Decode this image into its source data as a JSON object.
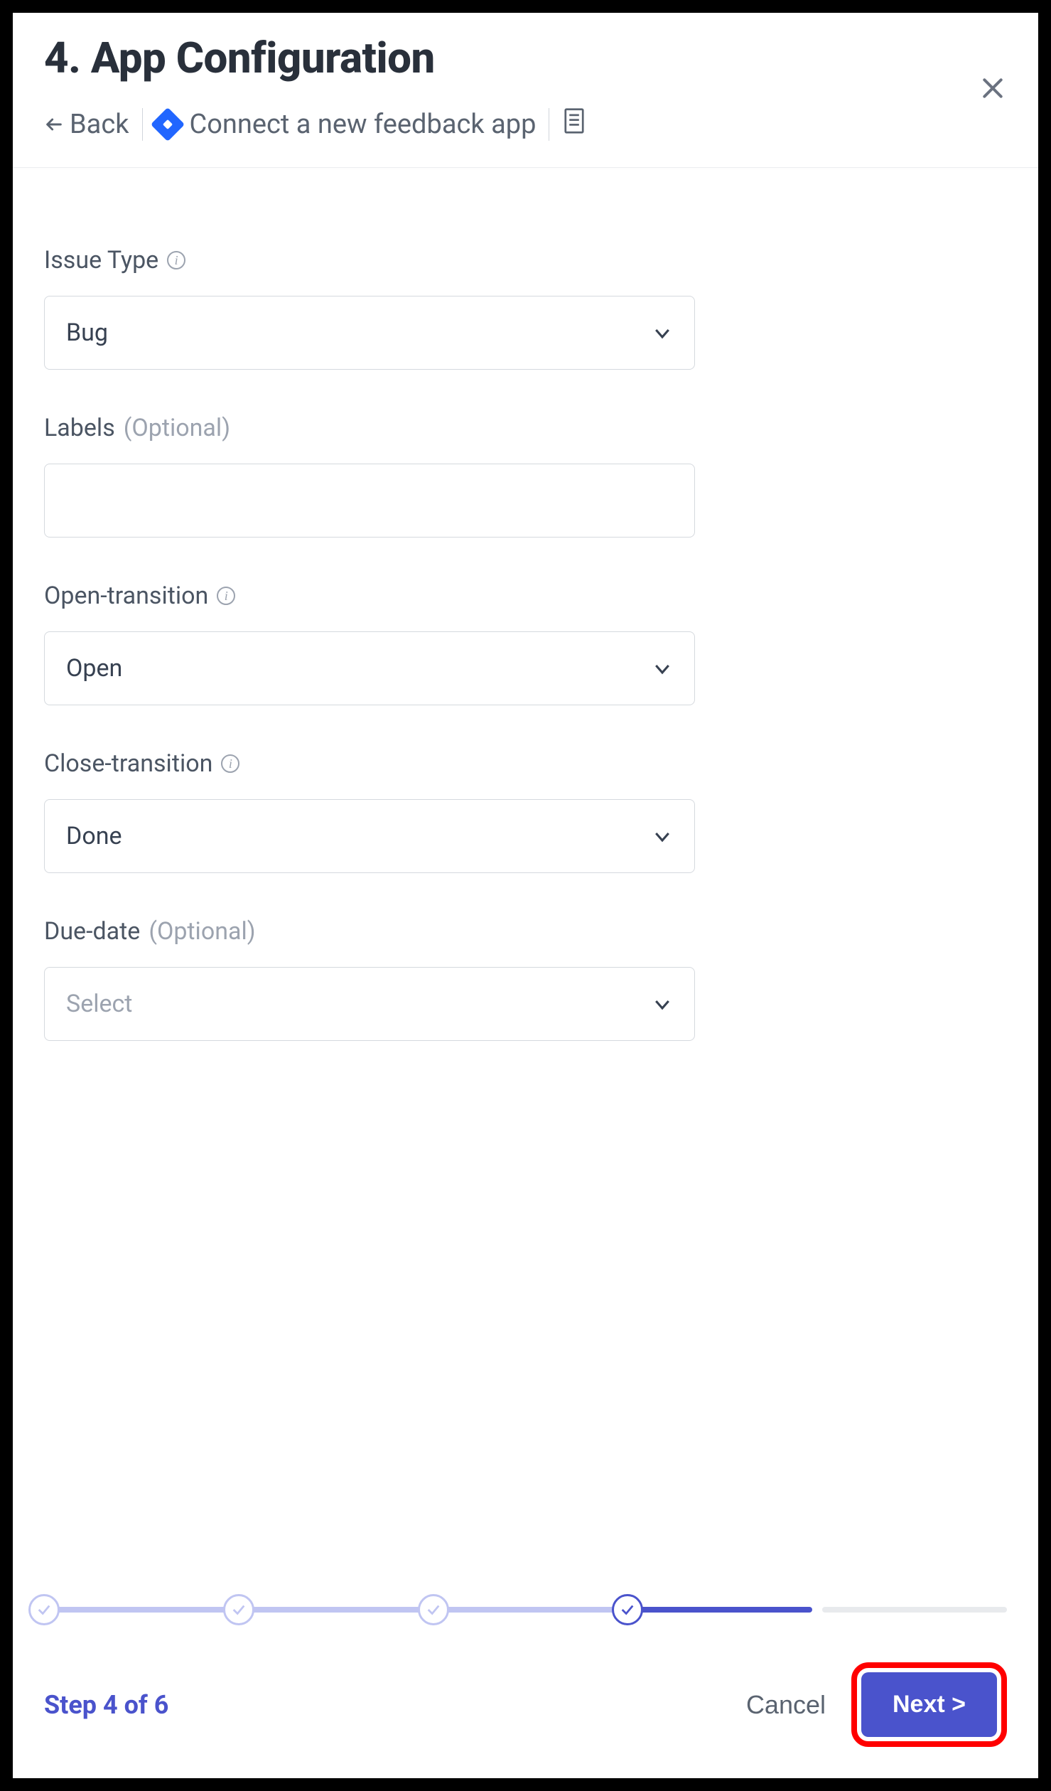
{
  "header": {
    "title": "4. App Configuration",
    "back_label": "Back",
    "breadcrumb_text": "Connect a new feedback app"
  },
  "fields": {
    "issue_type": {
      "label": "Issue Type",
      "value": "Bug",
      "has_info": true
    },
    "labels": {
      "label": "Labels",
      "optional_text": "(Optional)",
      "value": ""
    },
    "open_transition": {
      "label": "Open-transition",
      "value": "Open",
      "has_info": true
    },
    "close_transition": {
      "label": "Close-transition",
      "value": "Done",
      "has_info": true
    },
    "due_date": {
      "label": "Due-date",
      "optional_text": "(Optional)",
      "placeholder": "Select"
    }
  },
  "footer": {
    "step_label": "Step 4 of 6",
    "cancel_label": "Cancel",
    "next_label": "Next >"
  }
}
